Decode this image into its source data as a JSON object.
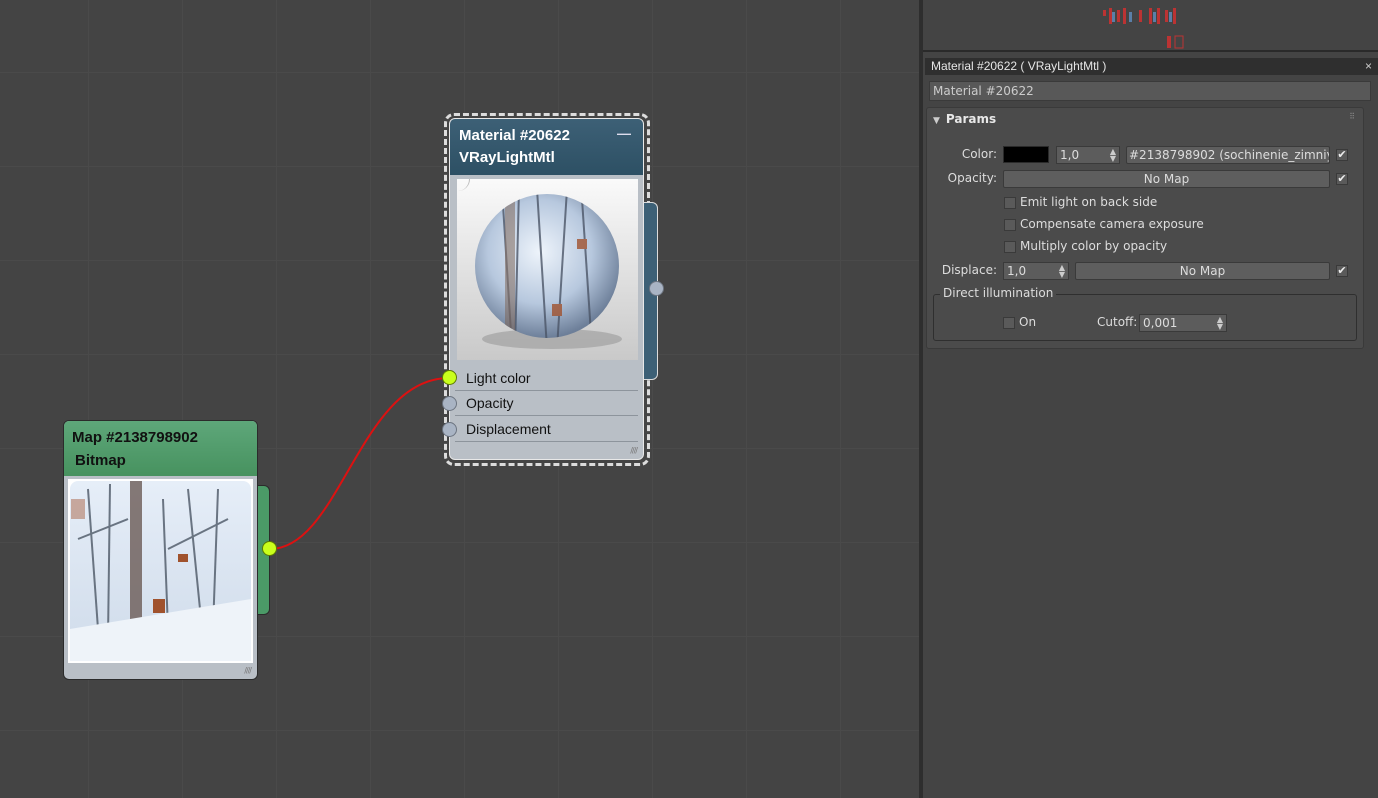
{
  "material_node": {
    "title": "Material #20622",
    "subtitle": "VRayLightMtl",
    "minimize": "—",
    "slots": [
      "Light color",
      "Opacity",
      "Displacement"
    ]
  },
  "bitmap_node": {
    "title": "Map #2138798902",
    "subtitle": "Bitmap"
  },
  "properties": {
    "window_title": "Material #20622  ( VRayLightMtl )",
    "close": "×",
    "name_value": "Material #20622",
    "rollout_title": "Params",
    "color_label": "Color:",
    "color_multiplier": "1,0",
    "color_map": "#2138798902 (sochinenie_zimniy_vi",
    "opacity_label": "Opacity:",
    "opacity_map": "No Map",
    "checkboxes": [
      {
        "label": "Emit light on back side",
        "checked": false
      },
      {
        "label": "Compensate camera exposure",
        "checked": false
      },
      {
        "label": "Multiply color by opacity",
        "checked": false
      }
    ],
    "displace_label": "Displace:",
    "displace_value": "1,0",
    "displace_map": "No Map",
    "direct_group": "Direct illumination",
    "direct_on_label": "On",
    "cutoff_label": "Cutoff:",
    "cutoff_value": "0,001",
    "check_mark": "✔"
  },
  "colors": {
    "material_header": "#3d6076",
    "bitmap_header": "#4b9a67",
    "active_socket": "#c9ff1c",
    "wire": "#e02020"
  }
}
